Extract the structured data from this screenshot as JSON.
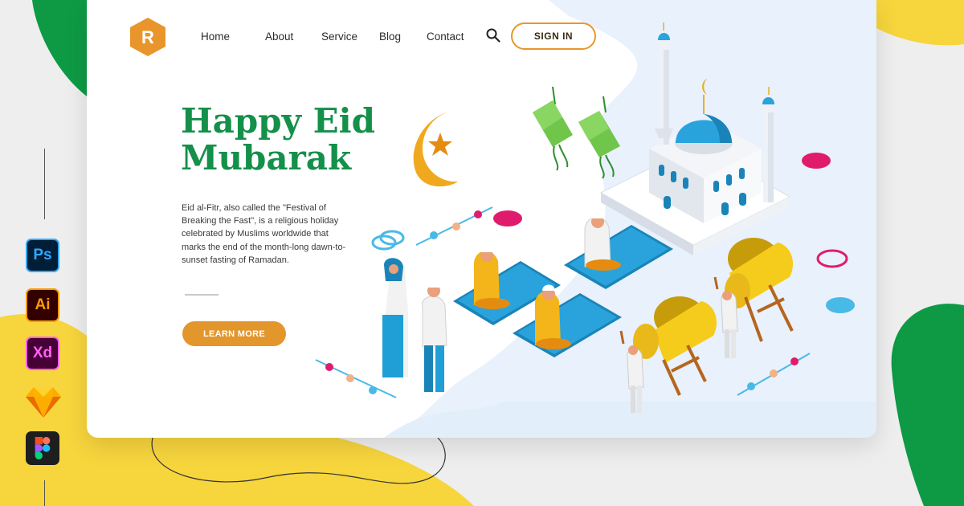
{
  "nav": {
    "logo_letter": "R",
    "links": [
      "Home",
      "About",
      "Service",
      "Blog",
      "Contact"
    ],
    "signin_label": "SIGN IN"
  },
  "hero": {
    "title_line1": "Happy Eid",
    "title_line2": "Mubarak",
    "description": "Eid al-Fitr, also called the \"Festival of Breaking the Fast\", is a religious holiday celebrated by Muslims worldwide that marks the end of the month-long dawn-to-sunset fasting of Ramadan.",
    "button_label": "LEARN MORE"
  },
  "tools": [
    {
      "icon": "photoshop-icon",
      "label": "Ps",
      "color": "#31a8ff",
      "bg": "#001e36"
    },
    {
      "icon": "illustrator-icon",
      "label": "Ai",
      "color": "#ff9a00",
      "bg": "#330000"
    },
    {
      "icon": "xd-icon",
      "label": "Xd",
      "color": "#ff61f6",
      "bg": "#470137"
    },
    {
      "icon": "sketch-icon",
      "label": "",
      "color": "#fdad00",
      "bg": "transparent"
    },
    {
      "icon": "figma-icon",
      "label": "",
      "color": "#ffffff",
      "bg": "#1e1e1e"
    }
  ],
  "colors": {
    "accent": "#e2962c",
    "title_green": "#14904a",
    "blob_yellow": "#f7d53d",
    "blob_green": "#0e9a44"
  }
}
